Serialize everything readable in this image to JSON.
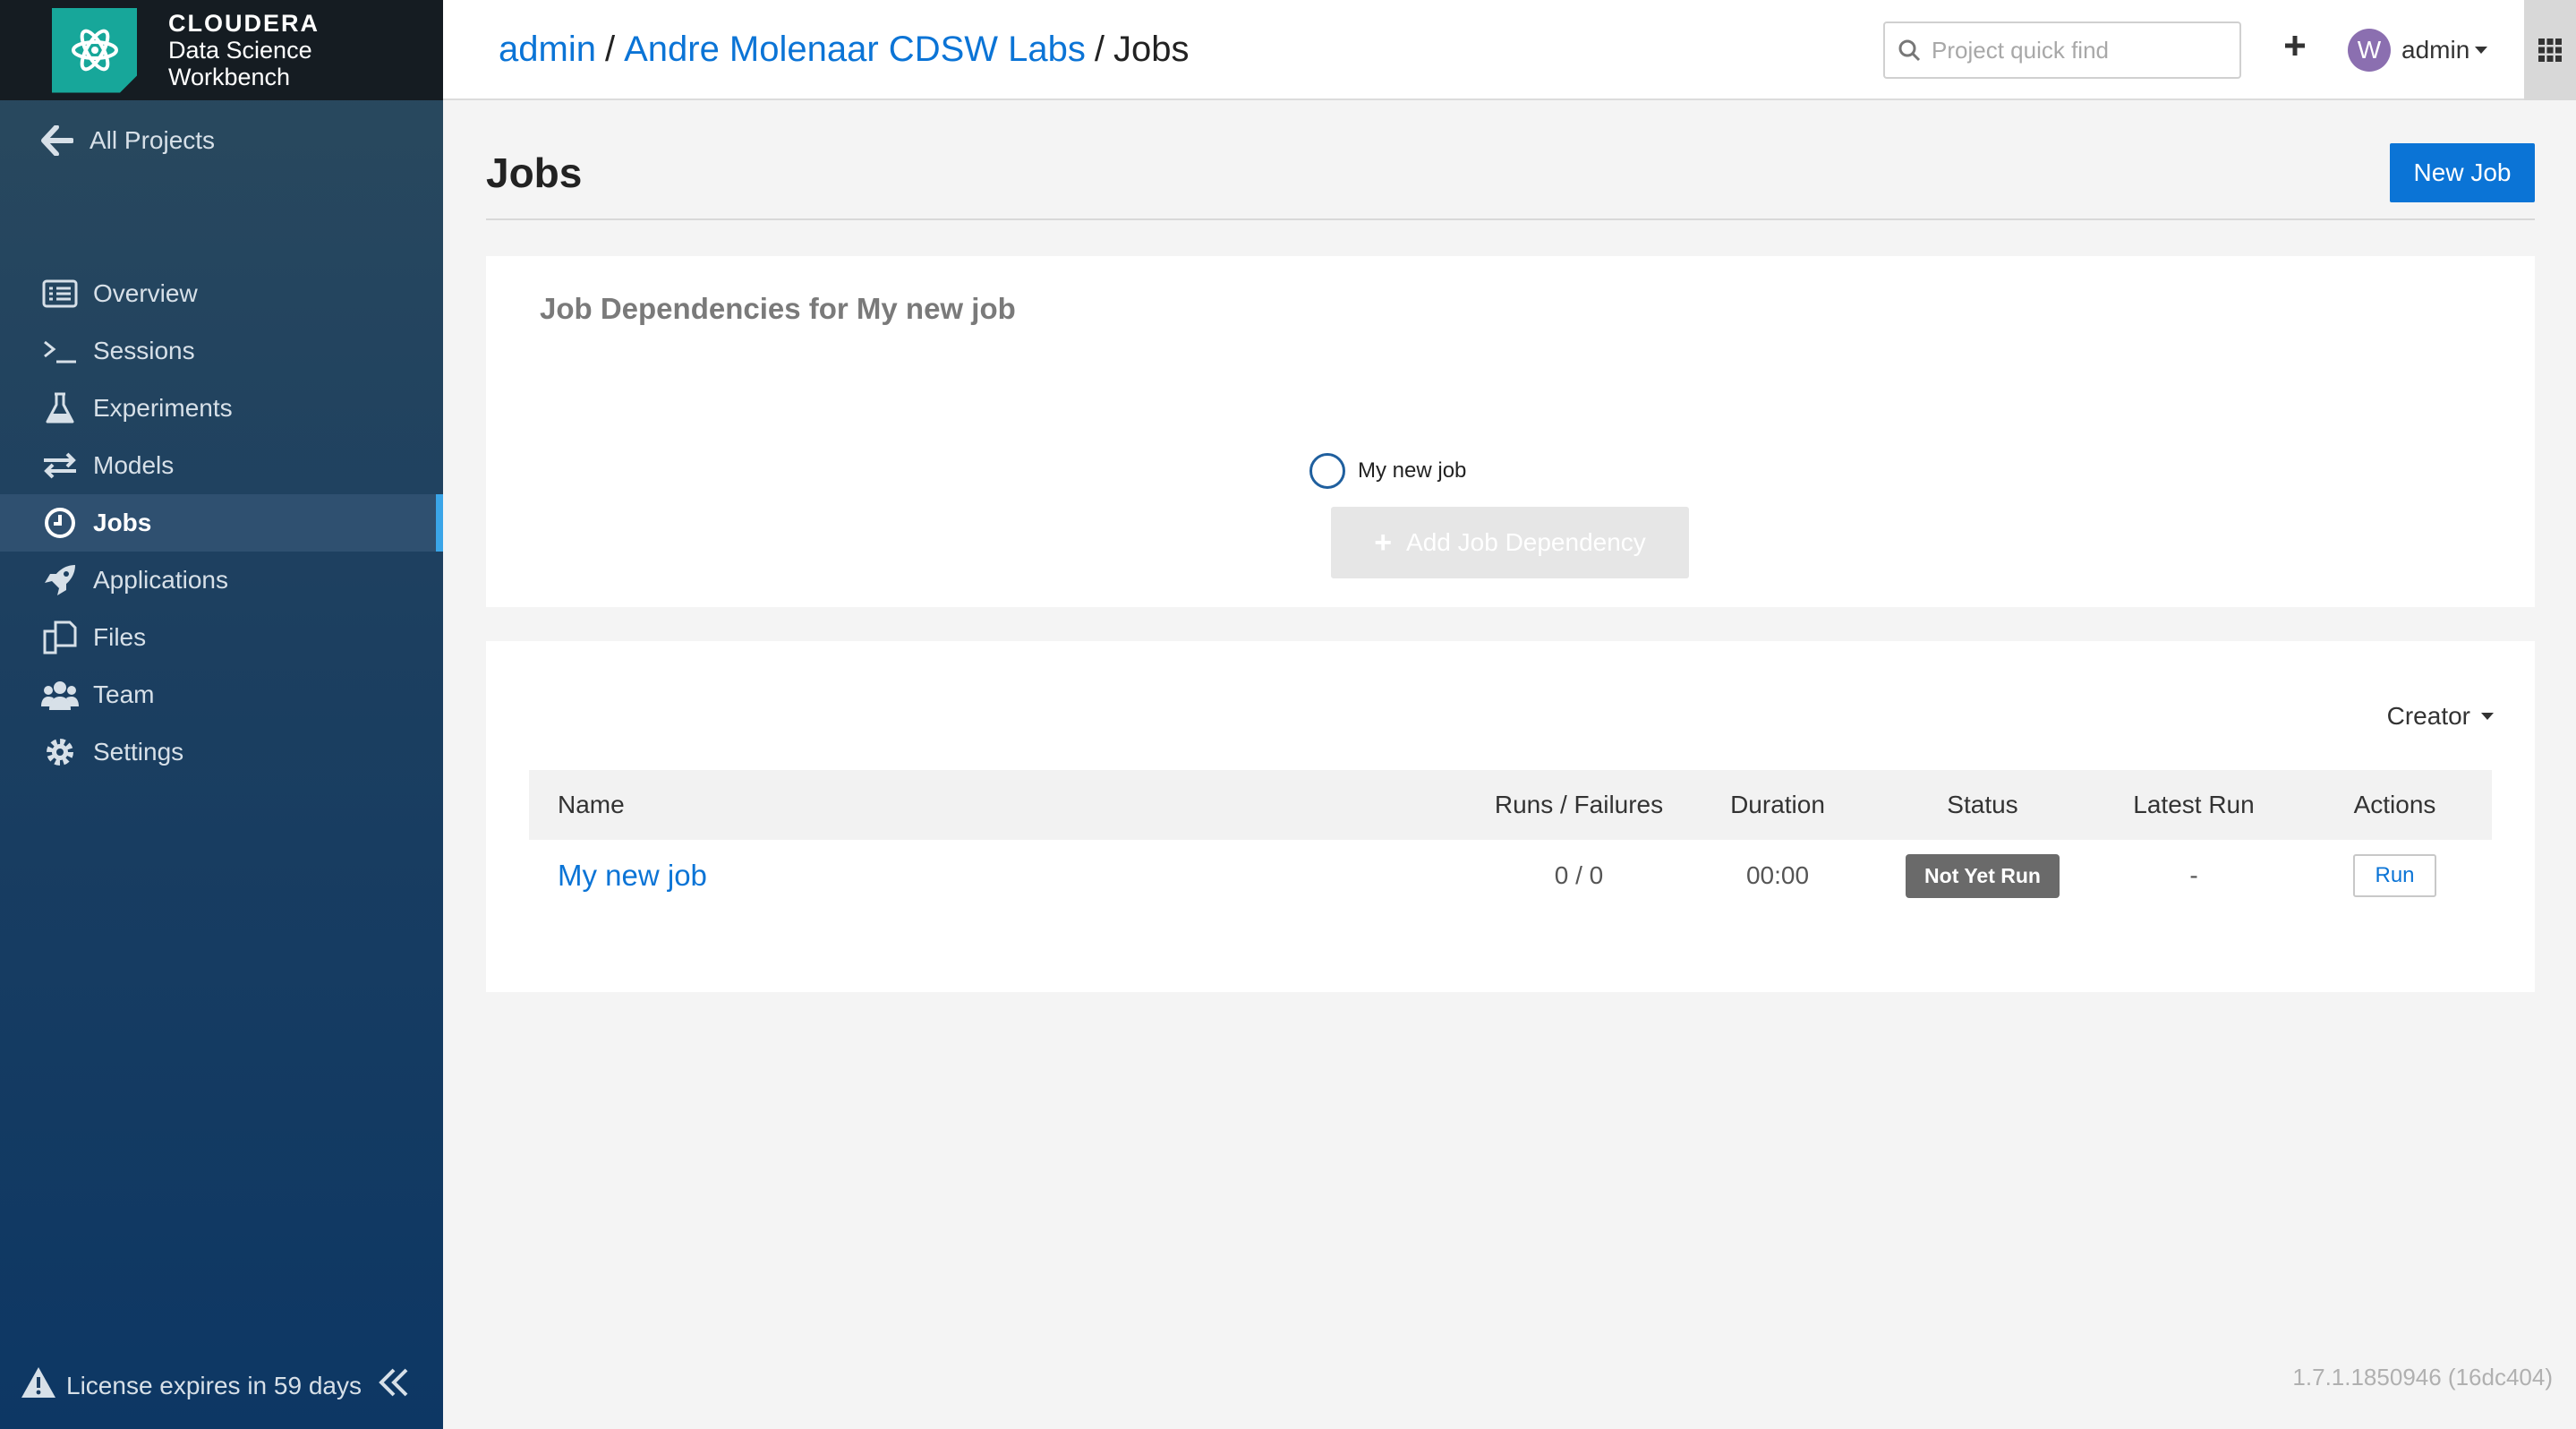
{
  "brand": {
    "name": "CLOUDERA",
    "product_line1": "Data Science",
    "product_line2": "Workbench"
  },
  "sidebar": {
    "all_projects": "All Projects",
    "items": [
      {
        "label": "Overview",
        "icon": "overview-icon"
      },
      {
        "label": "Sessions",
        "icon": "terminal-icon"
      },
      {
        "label": "Experiments",
        "icon": "flask-icon"
      },
      {
        "label": "Models",
        "icon": "arrows-icon"
      },
      {
        "label": "Jobs",
        "icon": "clock-icon",
        "active": true
      },
      {
        "label": "Applications",
        "icon": "rocket-icon"
      },
      {
        "label": "Files",
        "icon": "files-icon"
      },
      {
        "label": "Team",
        "icon": "team-icon"
      },
      {
        "label": "Settings",
        "icon": "gear-icon"
      }
    ],
    "license_text": "License expires in 59 days"
  },
  "header": {
    "breadcrumb": {
      "user": "admin",
      "sep1": "/",
      "project": "Andre Molenaar CDSW Labs",
      "sep2": "/",
      "current": "Jobs"
    },
    "search_placeholder": "Project quick find",
    "user_initial": "W",
    "user_name": "admin"
  },
  "page": {
    "title": "Jobs",
    "new_job_label": "New Job"
  },
  "dependencies": {
    "title": "Job Dependencies for My new job",
    "node_label": "My new job",
    "add_label": "Add Job Dependency"
  },
  "jobs": {
    "filter_label": "Creator",
    "columns": {
      "name": "Name",
      "runs": "Runs / Failures",
      "duration": "Duration",
      "status": "Status",
      "latest": "Latest Run",
      "actions": "Actions"
    },
    "rows": [
      {
        "name": "My new job",
        "runs": "0 / 0",
        "duration": "00:00",
        "status": "Not Yet Run",
        "latest": "-",
        "action": "Run"
      }
    ]
  },
  "version": "1.7.1.1850946 (16dc404)",
  "colors": {
    "accent": "#0b74d6",
    "brand_teal": "#17a79a",
    "sidebar_active_bar": "#3aa5e8",
    "status_badge": "#6a6a6a"
  }
}
